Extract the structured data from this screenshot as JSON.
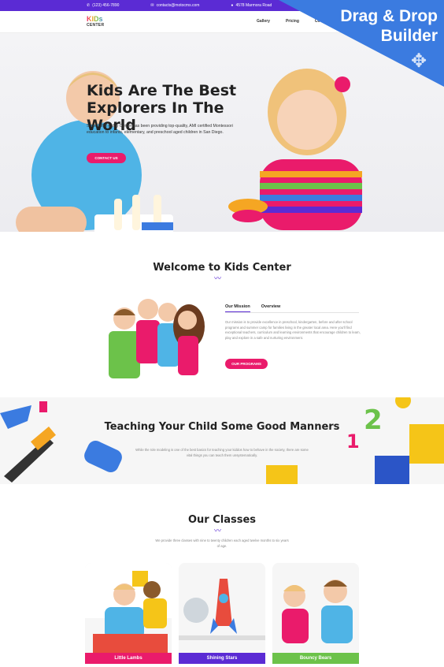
{
  "topbar": {
    "phone": "(123) 456-7890",
    "email": "contacts@motocms.com",
    "address": "4578 Marmora Road"
  },
  "promo": {
    "line1": "Drag & Drop",
    "line2": "Builder"
  },
  "brand": {
    "logo_top": "KIDs",
    "logo_bottom": "CENTER"
  },
  "nav": {
    "items": [
      "Gallery",
      "Pricing",
      "Co"
    ]
  },
  "hero": {
    "title": "Kids Are The Best Explorers In The World",
    "text": "Since 1992 Kiddy Center has been providing top-quality, AMI certified Montessori education to infants, elementary, and preschool aged children in San Diego.",
    "button": "CONTACT US"
  },
  "welcome": {
    "title": "Welcome to  Kids Center",
    "tabs": [
      "Our Mission",
      "Overview"
    ],
    "mission": "Our mission is to provide excellence in preschool, kindergarten, before and after school programs and summer camp for families living in the greater local area. Here you'll find exceptional teachers, curriculum and learning environments that encourage children to learn, play and explore in a safe and nurturing environment.",
    "button": "OUR PROGRAMS"
  },
  "teaching": {
    "title": "Teaching Your Child Some Good Manners",
    "text": "While the role modeling is one of the best basics for teaching your kiddos how to behave in the society, there are some vital things you can teach them unsystematically."
  },
  "classes": {
    "title": "Our Classes",
    "desc": "We provide three classes with nine to twenty children each aged twelve months to six years of age.",
    "items": [
      {
        "label": "Little Lambs",
        "color": "#ea1b6b"
      },
      {
        "label": "Shining Stars",
        "color": "#5b2bd4"
      },
      {
        "label": "Bouncy Bears",
        "color": "#6cc24a"
      }
    ]
  },
  "colors": {
    "purple": "#5b2bd4",
    "pink": "#ea1b6b",
    "green": "#6cc24a",
    "promo_blue": "#3b7be0"
  }
}
